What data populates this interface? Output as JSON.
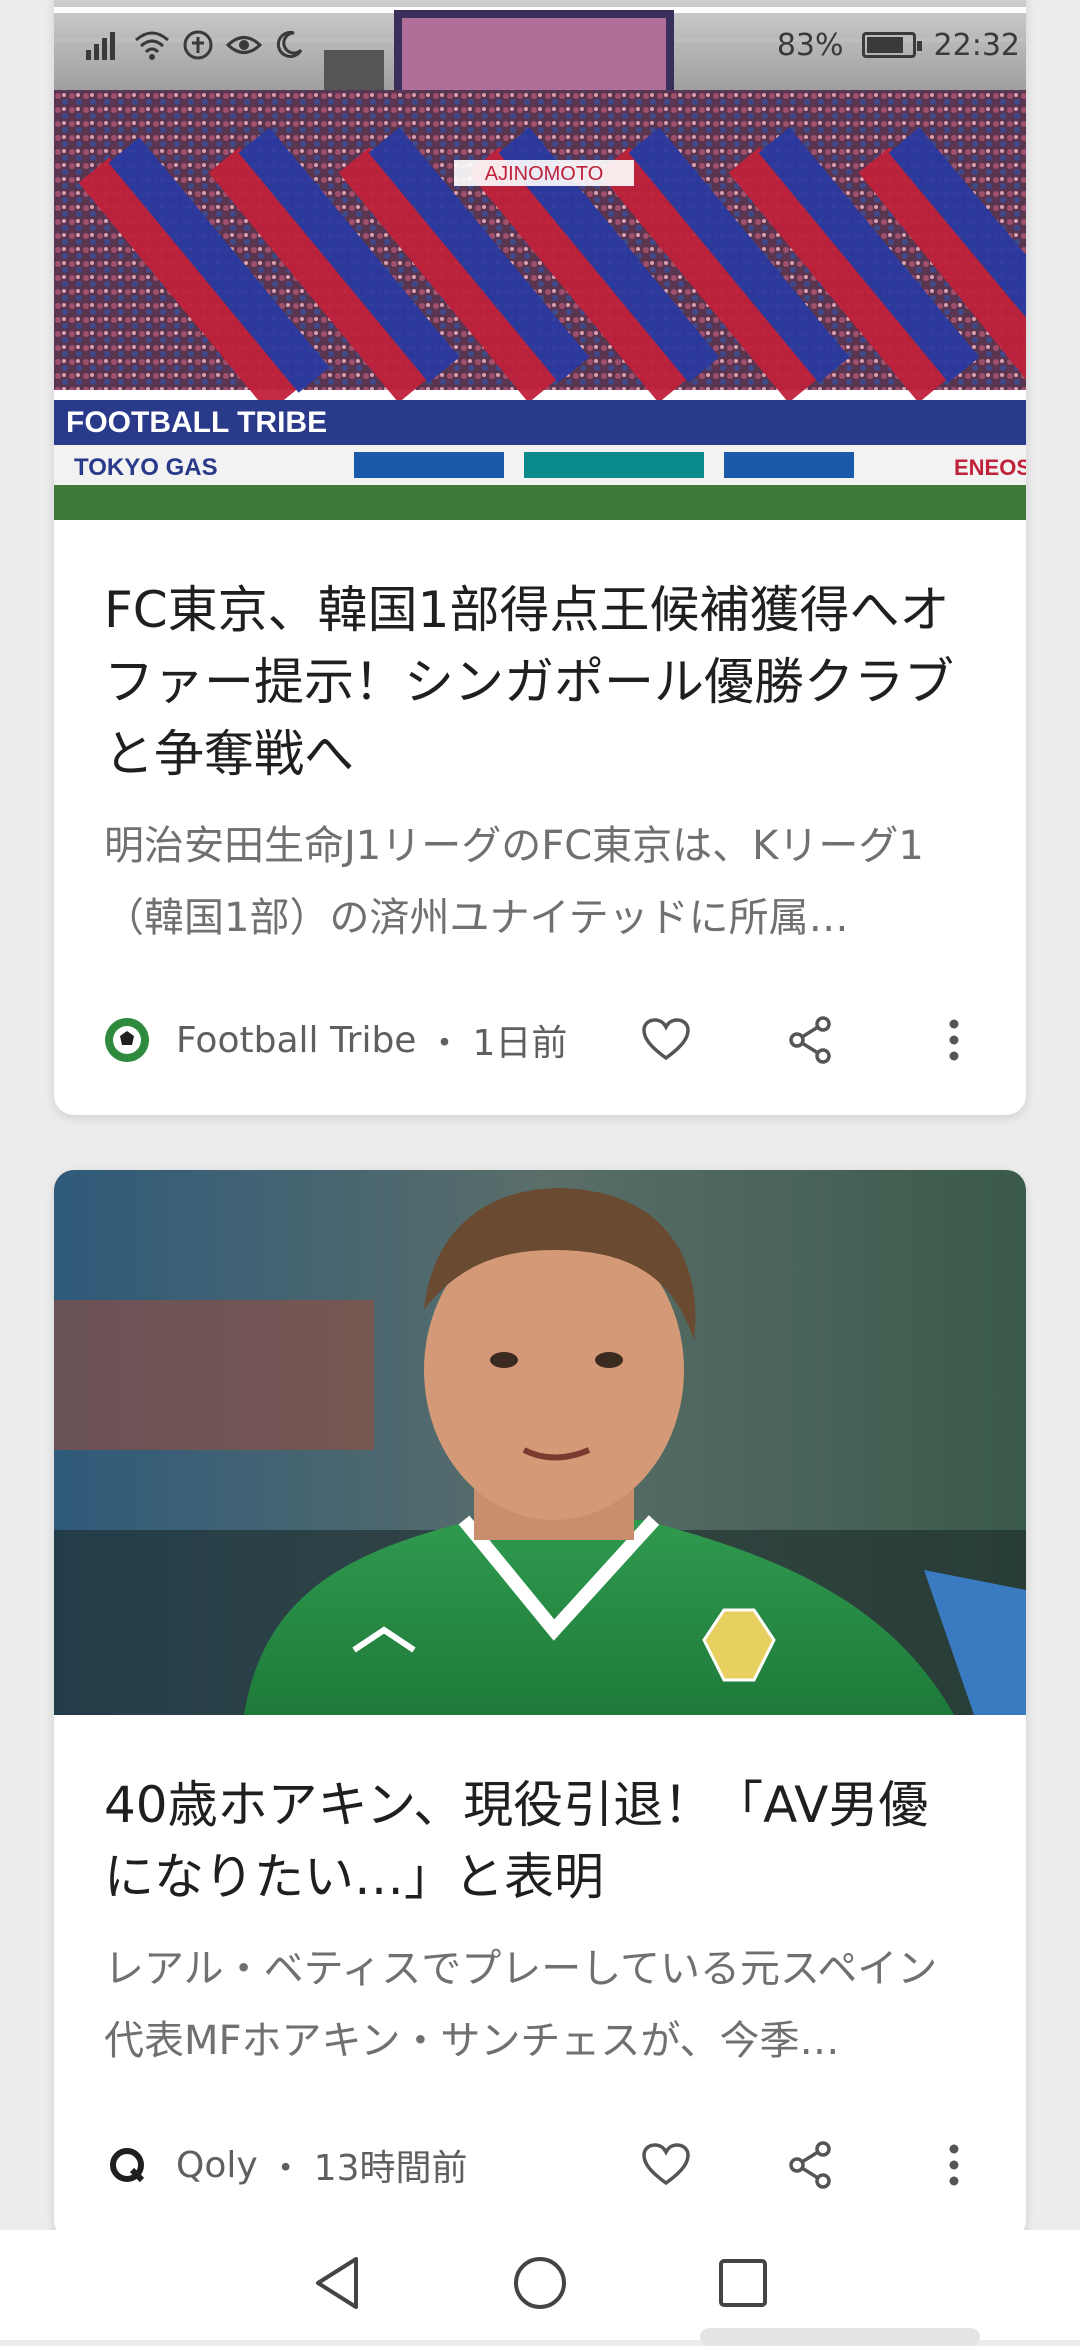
{
  "status_bar": {
    "battery_text": "83%",
    "time": "22:32",
    "battery_level": 0.83
  },
  "cards": [
    {
      "headline": "FC東京、韓国1部得点王候補獲得へオファー提示！シンガポール優勝クラブと争奪戦へ",
      "snippet": "明治安田生命J1リーグのFC東京は、Kリーグ1（韓国1部）の済州ユナイテッドに所属…",
      "source": "Football Tribe",
      "time": "1日前",
      "image_banner_texts": [
        "FOOTBALL TRIBE",
        "TOKYO GAS",
        "AJINOMOTO",
        "ENEOS"
      ]
    },
    {
      "headline": "40歳ホアキン、現役引退！「AV男優になりたい…」と表明",
      "snippet": "レアル・ベティスでプレーしている元スペイン代表MFホアキン・サンチェスが、今季…",
      "source": "Qoly",
      "time": "13時間前"
    }
  ],
  "separator_dot": "・",
  "colors": {
    "background": "#ececec",
    "card": "#ffffff",
    "headline": "#1f1f1f",
    "snippet": "#707070",
    "meta": "#5f5f5f",
    "icon": "#555555"
  },
  "icons": {
    "heart": "heart-icon",
    "share": "share-icon",
    "more": "more-vert-icon",
    "back": "back-triangle-icon",
    "home": "home-circle-icon",
    "recents": "recents-square-icon"
  }
}
